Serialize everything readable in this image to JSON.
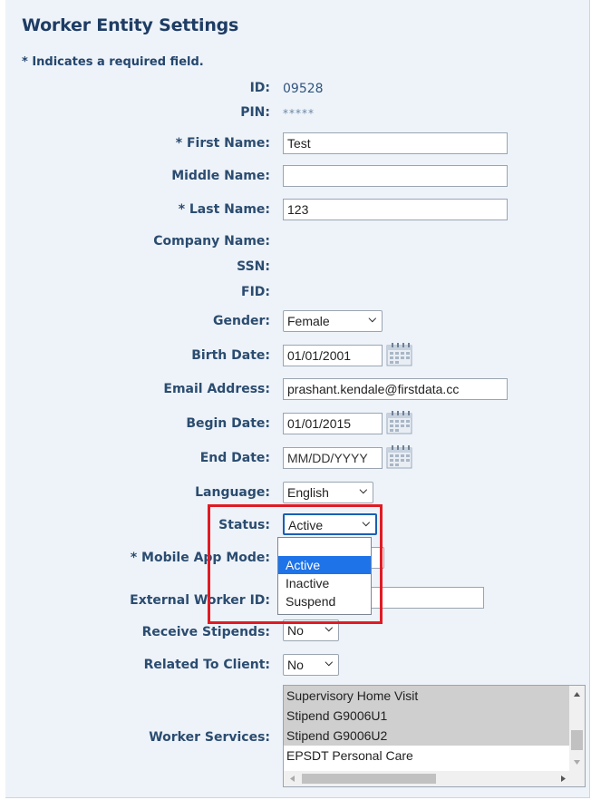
{
  "title": "Worker Entity Settings",
  "required_note": "* Indicates a required field.",
  "fields": {
    "id": {
      "label": "ID:",
      "value": "09528"
    },
    "pin": {
      "label": "PIN:",
      "value": "*****"
    },
    "first_name": {
      "label": "* First Name:",
      "value": "Test"
    },
    "middle_name": {
      "label": "Middle Name:",
      "value": ""
    },
    "last_name": {
      "label": "* Last Name:",
      "value": "123"
    },
    "company_name": {
      "label": "Company Name:"
    },
    "ssn": {
      "label": "SSN:"
    },
    "fid": {
      "label": "FID:"
    },
    "gender": {
      "label": "Gender:",
      "value": "Female"
    },
    "birth_date": {
      "label": "Birth Date:",
      "value": "01/01/2001"
    },
    "email": {
      "label": "Email Address:",
      "value": "prashant.kendale@firstdata.cc"
    },
    "begin_date": {
      "label": "Begin Date:",
      "value": "01/01/2015"
    },
    "end_date": {
      "label": "End Date:",
      "placeholder": "MM/DD/YYYY"
    },
    "language": {
      "label": "Language:",
      "value": "English"
    },
    "status": {
      "label": "Status:",
      "value": "Active",
      "options": [
        "",
        "Active",
        "Inactive",
        "Suspend"
      ],
      "highlighted": "Active"
    },
    "mobile_app_mode": {
      "label": "* Mobile App Mode:"
    },
    "external_worker_id": {
      "label": "External Worker ID:",
      "value": ""
    },
    "receive_stipends": {
      "label": "Receive Stipends:",
      "value": "No"
    },
    "related_to_client": {
      "label": "Related To Client:",
      "value": "No"
    },
    "worker_services": {
      "label": "Worker Services:",
      "items": [
        "Supervisory Home Visit",
        "Stipend G9006U1",
        "Stipend G9006U2",
        "EPSDT Personal Care"
      ]
    }
  },
  "colors": {
    "panel_bg": "#eef3f9",
    "label": "#2b4c70",
    "highlight_box": "#e01b24",
    "option_highlight": "#1e73e8"
  }
}
